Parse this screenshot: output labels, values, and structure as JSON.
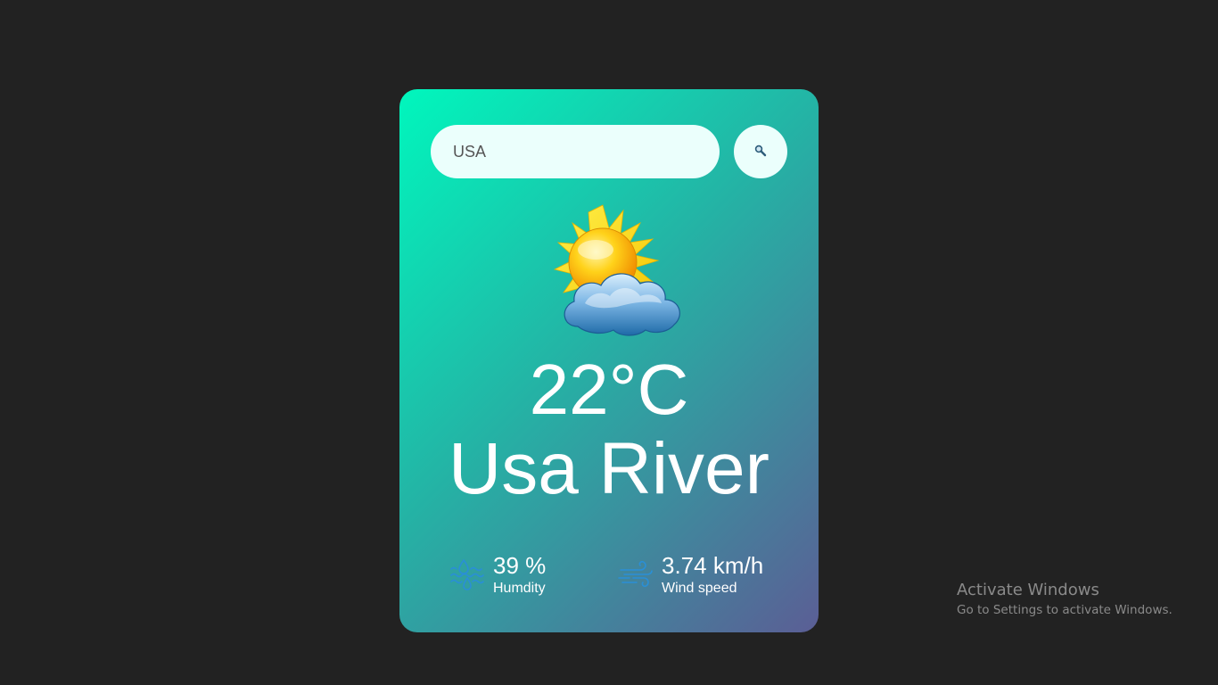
{
  "search": {
    "value": "USA",
    "button_icon": "search-icon"
  },
  "weather": {
    "icon": "partly-cloudy-icon",
    "temperature": "22°C",
    "city": "Usa River"
  },
  "details": {
    "humidity": {
      "icon": "humidity-icon",
      "value": "39 %",
      "label": "Humdity"
    },
    "wind": {
      "icon": "wind-icon",
      "value": "3.74 km/h",
      "label": "Wind speed"
    }
  },
  "watermark": {
    "title": "Activate Windows",
    "subtitle": "Go to Settings to activate Windows."
  },
  "colors": {
    "background": "#222222",
    "card_gradient_start": "#00f7bd",
    "card_gradient_end": "#5b5e95",
    "input_bg": "#ebfffc",
    "text": "#ffffff"
  }
}
